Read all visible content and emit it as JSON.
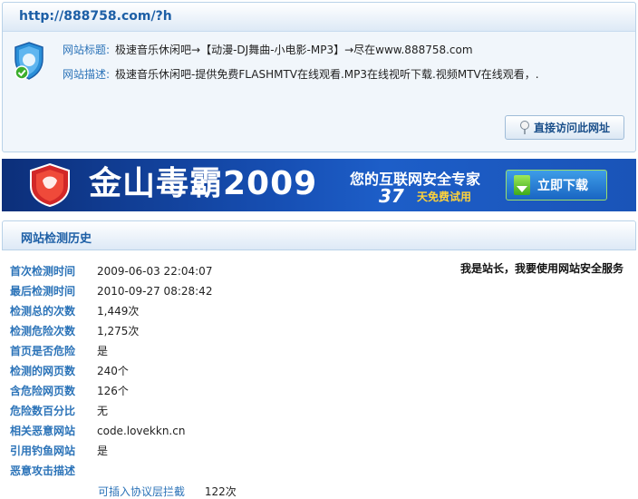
{
  "site": {
    "url": "http://888758.com/?h",
    "title_label": "网站标题:",
    "title_value": "极速音乐休闲吧→【动漫-DJ舞曲-小电影-MP3】→尽在www.888758.com",
    "desc_label": "网站描述:",
    "desc_value": "极速音乐休闲吧-提供免费FLASHMTV在线观看.MP3在线视听下载.视频MTV在线观看，.",
    "visit_label": "直接访问此网址",
    "shield_icon": "security-shield-check-icon"
  },
  "banner": {
    "title": "金山毒霸2009",
    "slogan": "您的互联网安全专家",
    "days": "37",
    "trial": "天免费试用",
    "download_label": "立即下载",
    "colors": {
      "primary": "#1750b5",
      "accent": "#ffd33a"
    }
  },
  "history": {
    "section_title": "网站检测历史",
    "owner_link": "我是站长，我要使用网站安全服务",
    "rows": [
      {
        "label": "首次检测时间",
        "value": "2009-06-03 22:04:07"
      },
      {
        "label": "最后检测时间",
        "value": "2010-09-27 08:28:42"
      },
      {
        "label": "检测总的次数",
        "value": "1,449次"
      },
      {
        "label": "检测危险次数",
        "value": "1,275次"
      },
      {
        "label": "首页是否危险",
        "value": "是"
      },
      {
        "label": "检测的网页数",
        "value": "240个"
      },
      {
        "label": "含危险网页数",
        "value": "126个"
      },
      {
        "label": "危险数百分比",
        "value": "无"
      },
      {
        "label": "相关恶意网站",
        "value": "code.lovekkn.cn"
      },
      {
        "label": "引用钓鱼网站",
        "value": "是"
      },
      {
        "label": "恶意攻击描述",
        "value": ""
      }
    ],
    "attack": {
      "type": "可插入协议层拦截",
      "count": "122次"
    }
  }
}
